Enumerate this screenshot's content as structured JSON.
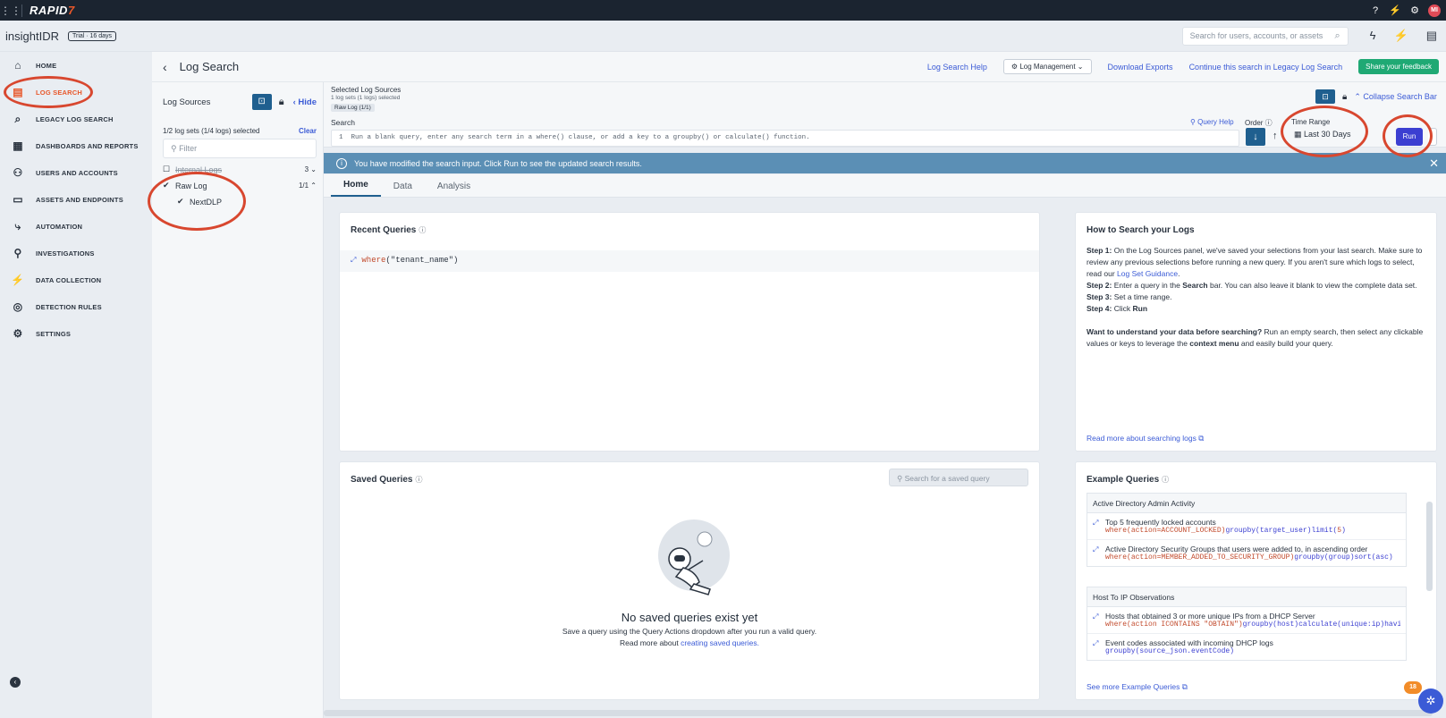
{
  "topbar": {
    "brand_main": "RAPID",
    "brand_accent": "7",
    "icons": [
      "help-icon",
      "plug-icon",
      "gear-icon"
    ],
    "avatar": "MI"
  },
  "subhead": {
    "product": "insightIDR",
    "trial": "Trial · 16 days",
    "search_placeholder": "Search for users, accounts, or assets"
  },
  "nav": {
    "items": [
      {
        "label": "HOME",
        "icon": "⌂"
      },
      {
        "label": "LOG SEARCH",
        "icon": "▤"
      },
      {
        "label": "LEGACY LOG SEARCH",
        "icon": "⌕"
      },
      {
        "label": "DASHBOARDS AND REPORTS",
        "icon": "▦"
      },
      {
        "label": "USERS AND ACCOUNTS",
        "icon": "⚇"
      },
      {
        "label": "ASSETS AND ENDPOINTS",
        "icon": "▭"
      },
      {
        "label": "AUTOMATION",
        "icon": "⤷"
      },
      {
        "label": "INVESTIGATIONS",
        "icon": "⚲"
      },
      {
        "label": "DATA COLLECTION",
        "icon": "⚡"
      },
      {
        "label": "DETECTION RULES",
        "icon": "◎"
      },
      {
        "label": "SETTINGS",
        "icon": "⚙"
      }
    ]
  },
  "page": {
    "title": "Log Search",
    "help": "Log Search Help",
    "log_mgmt": "Log Management",
    "download": "Download Exports",
    "legacy": "Continue this search in Legacy Log Search",
    "feedback": "Share your feedback"
  },
  "sources": {
    "label": "Log Sources",
    "hide": "Hide",
    "count": "1/2 log sets (1/4 logs) selected",
    "clear": "Clear",
    "filter": "Filter",
    "internal": "Internal Logs",
    "internal_count": "3",
    "raw": "Raw Log",
    "raw_count": "1/1",
    "nextdlp": "NextDLP"
  },
  "searchbar": {
    "selected_title": "Selected Log Sources",
    "selected_sub": "1 log sets (1 logs) selected",
    "chip": "Raw Log (1/1)",
    "collapse": "Collapse Search Bar",
    "search_label": "Search",
    "query_help": "Query Help",
    "order": "Order",
    "time_range_label": "Time Range",
    "line_no": "1",
    "placeholder": "Run a blank query, enter any search term in a where() clause, or add a key to a groupby() or calculate() function.",
    "time_range": "Last 30 Days",
    "run": "Run"
  },
  "banner": {
    "text": "You have modified the search input. Click Run to see the updated search results."
  },
  "tabs": [
    "Home",
    "Data",
    "Analysis"
  ],
  "recent": {
    "title": "Recent Queries",
    "q_kw": "where",
    "q_rest": "(\"tenant_name\")"
  },
  "howto": {
    "title": "How to Search your Logs",
    "s1_label": "Step 1:",
    "s1_text": " On the Log Sources panel, we've saved your selections from your last search. Make sure to review any previous selections before running a new query. If you aren't sure which logs to select, read our ",
    "s1_link": "Log Set Guidance",
    "s1_end": ".",
    "s2_label": "Step 2:",
    "s2_a": " Enter a query in the ",
    "s2_b": "Search",
    "s2_c": " bar. You can also leave it blank to view the complete data set.",
    "s3_label": "Step 3:",
    "s3_text": " Set a time range.",
    "s4_label": "Step 4:",
    "s4_a": " Click ",
    "s4_b": "Run",
    "w_bold": "Want to understand your data before searching?",
    "w_a": " Run an empty search, then select any clickable values or keys to leverage the ",
    "w_b": "context menu",
    "w_c": " and easily build your query.",
    "more": "Read more about searching logs"
  },
  "saved": {
    "title": "Saved Queries",
    "search": "Search for a saved query",
    "empty": "No saved queries exist yet",
    "sub1": "Save a query using the Query Actions dropdown after you run a valid query.",
    "sub2": "Read more about ",
    "sub2_link": "creating saved queries."
  },
  "examples": {
    "title": "Example Queries",
    "g1": "Active Directory Admin Activity",
    "e1_desc": "Top 5 frequently locked accounts",
    "e1_a": "where(",
    "e1_b": "action=ACCOUNT_LOCKED",
    "e1_c": ")",
    "e1_d": "groupby(",
    "e1_e": "target_user",
    "e1_f": ")",
    "e1_g": "limit(",
    "e1_h": "5",
    "e1_i": ")",
    "e2_desc": "Active Directory Security Groups that users were added to, in ascending order",
    "e2_a": "where(",
    "e2_b": "action=MEMBER_ADDED_TO_SECURITY_GROUP",
    "e2_c": ")",
    "e2_d": "groupby(",
    "e2_e": "group",
    "e2_f": ")",
    "e2_g": "sort(",
    "e2_h": "asc",
    "e2_i": ")",
    "g2": "Host To IP Observations",
    "e3_desc": "Hosts that obtained 3 or more unique IPs from a DHCP Server",
    "e3_a": "where(",
    "e3_b": "action ICONTAINS \"OBTAIN\"",
    "e3_c": ")",
    "e3_d": "groupby(",
    "e3_e": "host",
    "e3_f": ")",
    "e3_g": "calculate(",
    "e3_h": "unique:ip",
    "e3_i": ")havi…",
    "e4_desc": "Event codes associated with incoming DHCP logs",
    "e4_a": "groupby(",
    "e4_b": "source_json.eventCode",
    "e4_c": ")",
    "more": "See more Example Queries"
  },
  "badge": "18"
}
